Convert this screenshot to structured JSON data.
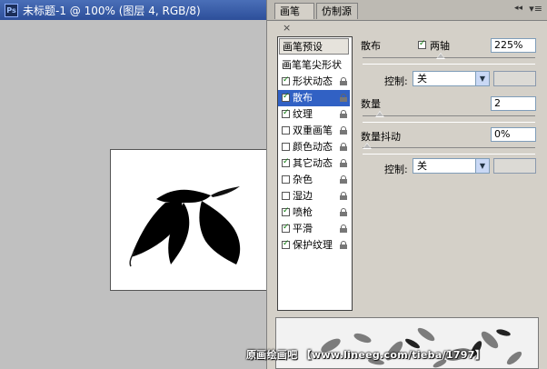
{
  "window": {
    "title": "未标题-1 @ 100% (图层 4, RGB/8)",
    "app_icon": "ps-icon"
  },
  "panel": {
    "tabs": [
      {
        "label": "画笔",
        "close": "×"
      },
      {
        "label": "仿制源"
      }
    ],
    "collapse": "◂◂",
    "menu": "▾≡",
    "preset_button": "画笔预设",
    "items": [
      {
        "label": "画笔笔尖形状",
        "checkbox": false,
        "checked": false,
        "lock": false
      },
      {
        "label": "形状动态",
        "checkbox": true,
        "checked": true,
        "lock": true
      },
      {
        "label": "散布",
        "checkbox": true,
        "checked": true,
        "lock": true,
        "selected": true
      },
      {
        "label": "纹理",
        "checkbox": true,
        "checked": true,
        "lock": true
      },
      {
        "label": "双重画笔",
        "checkbox": true,
        "checked": false,
        "lock": true
      },
      {
        "label": "颜色动态",
        "checkbox": true,
        "checked": false,
        "lock": true
      },
      {
        "label": "其它动态",
        "checkbox": true,
        "checked": true,
        "lock": true
      },
      {
        "label": "杂色",
        "checkbox": true,
        "checked": false,
        "lock": true
      },
      {
        "label": "湿边",
        "checkbox": true,
        "checked": false,
        "lock": true
      },
      {
        "label": "喷枪",
        "checkbox": true,
        "checked": true,
        "lock": true
      },
      {
        "label": "平滑",
        "checkbox": true,
        "checked": true,
        "lock": true
      },
      {
        "label": "保护纹理",
        "checkbox": true,
        "checked": true,
        "lock": true
      }
    ],
    "scatter": {
      "label": "散布",
      "both_axes_label": "两轴",
      "both_axes_checked": true,
      "value": "225%",
      "slider_level": 0.45,
      "control_label": "控制:",
      "control_value": "关"
    },
    "count": {
      "label": "数量",
      "value": "2",
      "slider_level": 0.08
    },
    "count_jitter": {
      "label": "数量抖动",
      "value": "0%",
      "slider_level": 0.0,
      "control_label": "控制:",
      "control_value": "关"
    },
    "checkmark": "✓"
  },
  "watermark": "原画绘画吧 【www.lineeg.com/tieba/1797】"
}
